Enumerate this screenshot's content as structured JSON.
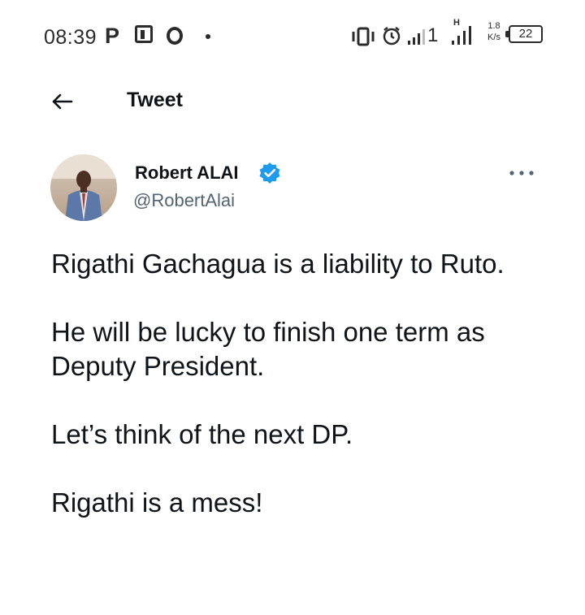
{
  "status_bar": {
    "time": "08:39",
    "notif_icons": [
      "p-icon",
      "pl-icon",
      "o-icon"
    ],
    "sim_indicator": "1",
    "network_type": "H",
    "speed_value": "1.8",
    "speed_unit": "K/s",
    "battery_level": "22"
  },
  "header": {
    "back_icon": "arrow-left-icon",
    "title": "Tweet"
  },
  "tweet": {
    "author_name": "Robert ALAI",
    "author_handle": "@RobertAlai",
    "verified_icon": "verified-badge-icon",
    "more_icon": "more-options-icon",
    "paragraphs": [
      "Rigathi Gachagua is a liability to Ruto.",
      "He will be lucky to finish one term as Deputy President.",
      "Let’s think of the next DP.",
      "Rigathi is a mess!"
    ]
  },
  "colors": {
    "text_primary": "#0f1419",
    "text_secondary": "#536471",
    "verified_blue": "#1d9bf0",
    "background": "#ffffff"
  }
}
